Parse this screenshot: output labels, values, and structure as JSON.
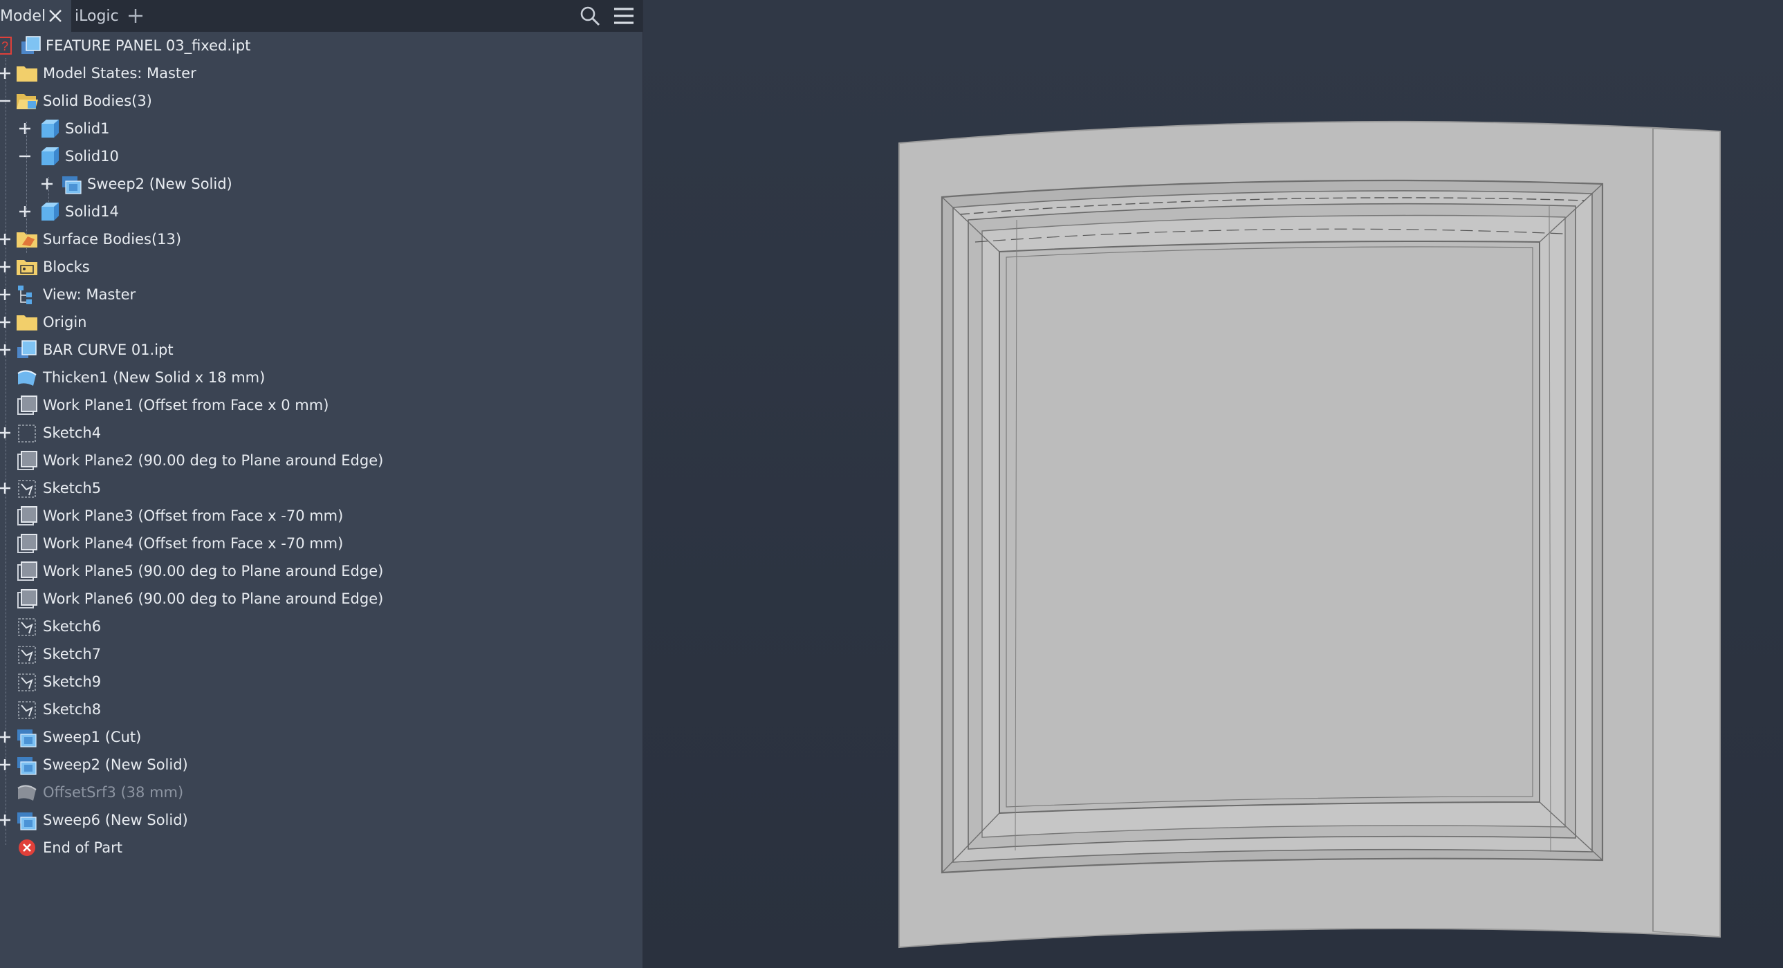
{
  "tabs": {
    "model": "Model",
    "ilogic": "iLogic"
  },
  "toolbar": {
    "search_icon": "search-icon",
    "menu_icon": "hamburger-menu-icon",
    "add_tab_icon": "plus-icon",
    "close_tab_icon": "close-icon"
  },
  "tree": {
    "root": "FEATURE PANEL 03_fixed.ipt",
    "model_states": "Model States: Master",
    "solid_bodies": "Solid Bodies(3)",
    "solid1": "Solid1",
    "solid10": "Solid10",
    "sweep2_child": "Sweep2 (New Solid)",
    "solid14": "Solid14",
    "surface_bodies": "Surface Bodies(13)",
    "blocks": "Blocks",
    "view_master": "View: Master",
    "origin": "Origin",
    "bar_curve": "BAR CURVE 01.ipt",
    "thicken1": "Thicken1 (New Solid x 18 mm)",
    "work_plane1": "Work Plane1 (Offset from Face x 0 mm)",
    "sketch4": "Sketch4",
    "work_plane2": "Work Plane2 (90.00 deg to Plane around Edge)",
    "sketch5": "Sketch5",
    "work_plane3": "Work Plane3 (Offset from Face x -70 mm)",
    "work_plane4": "Work Plane4 (Offset from Face x -70 mm)",
    "work_plane5": "Work Plane5 (90.00 deg to Plane around Edge)",
    "work_plane6": "Work Plane6 (90.00 deg to Plane around Edge)",
    "sketch6": "Sketch6",
    "sketch7": "Sketch7",
    "sketch9": "Sketch9",
    "sketch8": "Sketch8",
    "sweep1": "Sweep1 (Cut)",
    "sweep2": "Sweep2 (New Solid)",
    "offsetsrf3": "OffsetSrf3 (38 mm)",
    "sweep6": "Sweep6 (New Solid)",
    "end_of_part": "End of Part"
  },
  "colors": {
    "panel_bg": "#3b4453",
    "tabbar_bg": "#272d38",
    "viewport_bg": "#2b3240",
    "text": "#e8ecf1",
    "dim_text": "#8d95a2",
    "model_gray": "#bcbcbc",
    "error_red": "#e0403a",
    "folder_yellow": "#f2cf6b",
    "body_blue": "#58a8e8"
  }
}
